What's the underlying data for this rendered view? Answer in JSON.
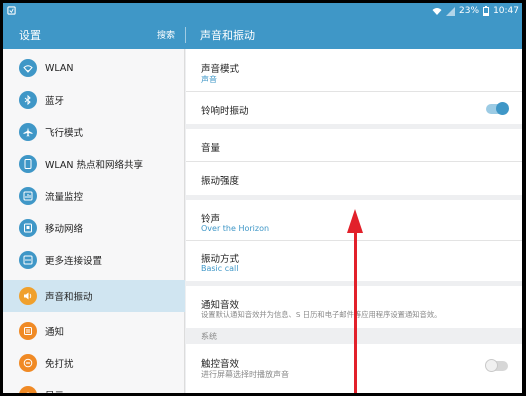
{
  "status_bar": {
    "battery_percent": "23%",
    "time": "10:47"
  },
  "action_bar": {
    "left_title": "设置",
    "search_label": "搜索",
    "right_title": "声音和振动"
  },
  "sidebar": {
    "items": [
      {
        "label": "WLAN",
        "icon": "wifi-icon",
        "color": "#3f97c7"
      },
      {
        "label": "蓝牙",
        "icon": "bluetooth-icon",
        "color": "#3f97c7"
      },
      {
        "label": "飞行模式",
        "icon": "airplane-icon",
        "color": "#3f97c7"
      },
      {
        "label": "WLAN 热点和网络共享",
        "icon": "hotspot-icon",
        "color": "#3f97c7"
      },
      {
        "label": "流量监控",
        "icon": "data-usage-icon",
        "color": "#3f97c7"
      },
      {
        "label": "移动网络",
        "icon": "mobile-network-icon",
        "color": "#3f97c7"
      },
      {
        "label": "更多连接设置",
        "icon": "more-connections-icon",
        "color": "#3f97c7"
      },
      {
        "label": "声音和振动",
        "icon": "sound-icon",
        "color": "#f0a02c",
        "active": true
      },
      {
        "label": "通知",
        "icon": "notification-icon",
        "color": "#f08a25"
      },
      {
        "label": "免打扰",
        "icon": "dnd-icon",
        "color": "#f08a25"
      },
      {
        "label": "显示",
        "icon": "display-icon",
        "color": "#f08a25"
      }
    ]
  },
  "settings": {
    "sound_mode": {
      "title": "声音模式",
      "value": "声音"
    },
    "vibrate_when_ringing": {
      "title": "铃响时振动",
      "on": true
    },
    "volume": {
      "title": "音量"
    },
    "vibration_intensity": {
      "title": "振动强度"
    },
    "ringtone": {
      "title": "铃声",
      "value": "Over the Horizon"
    },
    "vibration_pattern": {
      "title": "振动方式",
      "value": "Basic call"
    },
    "notification_sounds": {
      "title": "通知音效",
      "value": "设置默认通知音效并为信息、S 日历和电子邮件等应用程序设置通知音效。"
    },
    "system_section": {
      "label": "系统"
    },
    "touch_sounds": {
      "title": "触控音效",
      "value": "进行屏幕选择时播放声音",
      "on": false
    }
  },
  "colors": {
    "accent": "#3f97c7",
    "annotation_arrow": "#e2202a"
  }
}
